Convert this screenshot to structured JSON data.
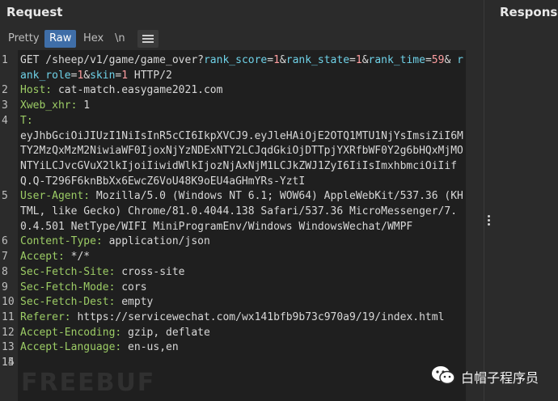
{
  "header": {
    "left_title": "Request",
    "right_title": "Response"
  },
  "toolbar": {
    "pretty": "Pretty",
    "raw": "Raw",
    "hex": "Hex",
    "newline": "\\n"
  },
  "editor": {
    "lines": [
      {
        "n": "1",
        "parts": [
          {
            "t": "GET /sheep/v1/game/game_over?",
            "c": "v"
          },
          {
            "t": "rank_score",
            "c": "teal"
          },
          {
            "t": "=",
            "c": "v"
          },
          {
            "t": "1",
            "c": "pink"
          },
          {
            "t": "&",
            "c": "v"
          },
          {
            "t": "rank_state",
            "c": "teal"
          },
          {
            "t": "=",
            "c": "v"
          },
          {
            "t": "1",
            "c": "pink"
          },
          {
            "t": "&",
            "c": "v"
          },
          {
            "t": "rank_time",
            "c": "teal"
          },
          {
            "t": "=",
            "c": "v"
          },
          {
            "t": "59",
            "c": "pink"
          },
          {
            "t": "& ",
            "c": "v"
          },
          {
            "t": "rank_role",
            "c": "teal"
          },
          {
            "t": "=",
            "c": "v"
          },
          {
            "t": "1",
            "c": "pink"
          },
          {
            "t": "&",
            "c": "v"
          },
          {
            "t": "skin",
            "c": "teal"
          },
          {
            "t": "=",
            "c": "v"
          },
          {
            "t": "1",
            "c": "pink"
          },
          {
            "t": " HTTP/2",
            "c": "v"
          }
        ]
      },
      {
        "n": "2",
        "parts": [
          {
            "t": "Host:",
            "c": "k"
          },
          {
            "t": " cat-match.easygame2021.com",
            "c": "v"
          }
        ]
      },
      {
        "n": "3",
        "parts": [
          {
            "t": "Xweb_xhr:",
            "c": "k"
          },
          {
            "t": " 1",
            "c": "v"
          }
        ]
      },
      {
        "n": "4",
        "parts": [
          {
            "t": "T:",
            "c": "k"
          },
          {
            "t": "\neyJhbGciOiJIUzI1NiIsInR5cCI6IkpXVCJ9.eyJleHAiOjE2OTQ1MTU1NjYsImsiZiI6MTY2MzQxMzM2NiwiaWF0IjoxNjYzNDExNTY2LCJqdGkiOjDTTpjYXRfbWF0Y2g6bHQxMjMONTYiLCJvcGVuX2lkIjoiIiwidWlkIjozNjAxNjM1LCJkZWJ1ZyI6IiIsImxhbmciOiIifQ.Q-T296F6knBbXx6EwcZ6VoU48K9oEU4aGHmYRs-YztI",
            "c": "v"
          }
        ]
      },
      {
        "n": "5",
        "parts": [
          {
            "t": "User-Agent:",
            "c": "k"
          },
          {
            "t": " Mozilla/5.0 (Windows NT 6.1; WOW64) AppleWebKit/537.36 (KHTML, like Gecko) Chrome/81.0.4044.138 Safari/537.36 MicroMessenger/7.0.4.501 NetType/WIFI MiniProgramEnv/Windows WindowsWechat/WMPF",
            "c": "v"
          }
        ]
      },
      {
        "n": "6",
        "parts": [
          {
            "t": "Content-Type:",
            "c": "k"
          },
          {
            "t": " application/json",
            "c": "v"
          }
        ]
      },
      {
        "n": "7",
        "parts": [
          {
            "t": "Accept:",
            "c": "k"
          },
          {
            "t": " */*",
            "c": "v"
          }
        ]
      },
      {
        "n": "8",
        "parts": [
          {
            "t": "Sec-Fetch-Site:",
            "c": "k"
          },
          {
            "t": " cross-site",
            "c": "v"
          }
        ]
      },
      {
        "n": "9",
        "parts": [
          {
            "t": "Sec-Fetch-Mode:",
            "c": "k"
          },
          {
            "t": " cors",
            "c": "v"
          }
        ]
      },
      {
        "n": "10",
        "parts": [
          {
            "t": "Sec-Fetch-Dest:",
            "c": "k"
          },
          {
            "t": " empty",
            "c": "v"
          }
        ]
      },
      {
        "n": "11",
        "parts": [
          {
            "t": "Referer:",
            "c": "k"
          },
          {
            "t": " https://servicewechat.com/wx141bfb9b73c970a9/19/index.html",
            "c": "v"
          }
        ]
      },
      {
        "n": "12",
        "parts": [
          {
            "t": "Accept-Encoding:",
            "c": "k"
          },
          {
            "t": " gzip, deflate",
            "c": "v"
          }
        ]
      },
      {
        "n": "13",
        "parts": [
          {
            "t": "Accept-Language:",
            "c": "k"
          },
          {
            "t": " en-us,en",
            "c": "v"
          }
        ]
      },
      {
        "n": "14",
        "parts": [
          {
            "t": "",
            "c": "v"
          }
        ],
        "highlight": true
      },
      {
        "n": "15",
        "parts": [
          {
            "t": "",
            "c": "v"
          }
        ]
      }
    ]
  },
  "brand": {
    "text": "白帽子程序员",
    "icon": "wechat-icon"
  },
  "watermark": {
    "text": "FREEBUF"
  },
  "colors": {
    "header_key": "#9ccc65",
    "param_name": "#6fd2e8",
    "param_value": "#ff9ea0",
    "active_tab": "#3f6ea8"
  }
}
